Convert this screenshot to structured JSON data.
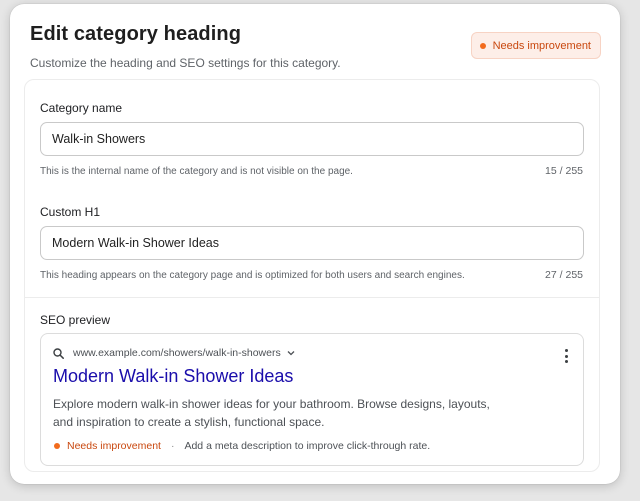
{
  "header": {
    "title": "Edit category heading",
    "subtitle": "Customize the heading and SEO settings for this category.",
    "status_badge": "Needs improvement"
  },
  "fields": {
    "category_name": {
      "label": "Category name",
      "value": "Walk-in Showers",
      "help": "This is the internal name of the category and is not visible on the page.",
      "counter": "15 / 255"
    },
    "custom_h1": {
      "label": "Custom H1",
      "value": "Modern Walk-in Shower Ideas",
      "help": "This heading appears on the category page and is optimized for both users and search engines.",
      "counter": "27 / 255"
    }
  },
  "seo_preview": {
    "label": "SEO preview",
    "url": "www.example.com/showers/walk-in-showers",
    "title": "Modern Walk-in Shower Ideas",
    "description": "Explore modern walk-in shower ideas for your bathroom. Browse designs, layouts, and inspiration to create a stylish, functional space.",
    "status": "Needs improvement",
    "separator": "·",
    "hint": "Add a meta description to improve click-through rate."
  },
  "colors": {
    "status_orange": "#f26b1d",
    "link_blue": "#1a0dab"
  },
  "icons": [
    "search-icon",
    "chevron-down-icon",
    "more-vertical-icon",
    "status-dot-icon"
  ]
}
